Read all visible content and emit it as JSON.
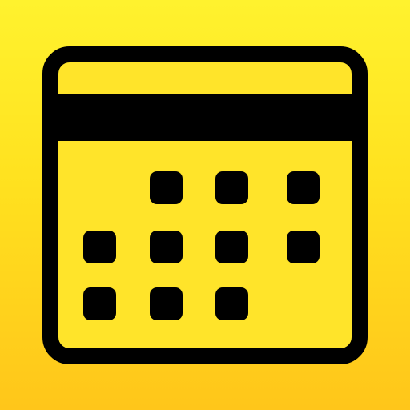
{
  "app_icon": {
    "icon_name": "calendar-icon",
    "background_gradient": [
      "#fff22e",
      "#ffc61a"
    ],
    "foreground_color": "#000000"
  }
}
